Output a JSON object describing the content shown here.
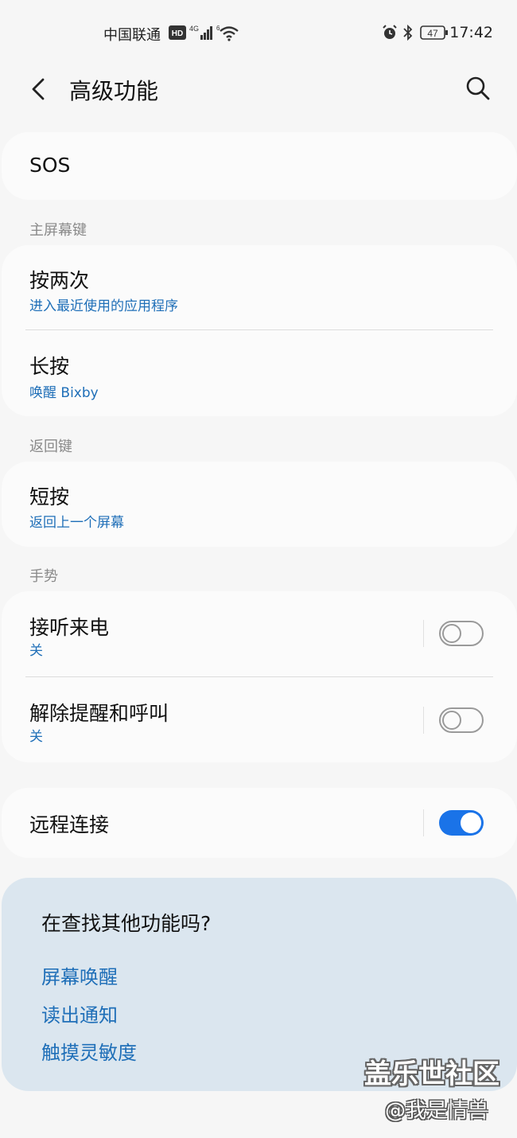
{
  "status_bar": {
    "carrier": "中国联通",
    "hd_badge": "HD",
    "network": "4G",
    "wifi_badge": "6",
    "battery": "47",
    "time": "17:42",
    "icons": [
      "hd-icon",
      "signal-icon",
      "wifi-icon",
      "alarm-icon",
      "bluetooth-icon",
      "battery-icon"
    ]
  },
  "header": {
    "title": "高级功能",
    "icons": [
      "back-arrow-icon",
      "search-icon"
    ]
  },
  "sos": {
    "label": "SOS"
  },
  "home_key": {
    "section_label": "主屏幕键",
    "items": [
      {
        "title": "按两次",
        "subtitle": "进入最近使用的应用程序"
      },
      {
        "title": "长按",
        "subtitle": "唤醒 Bixby"
      }
    ]
  },
  "back_key": {
    "section_label": "返回键",
    "items": [
      {
        "title": "短按",
        "subtitle": "返回上一个屏幕"
      }
    ]
  },
  "gestures": {
    "section_label": "手势",
    "items": [
      {
        "title": "接听来电",
        "subtitle": "关",
        "enabled": false
      },
      {
        "title": "解除提醒和呼叫",
        "subtitle": "关",
        "enabled": false
      }
    ]
  },
  "remote": {
    "title": "远程连接",
    "enabled": true
  },
  "suggestions": {
    "title": "在查找其他功能吗?",
    "links": [
      "屏幕唤醒",
      "读出通知",
      "触摸灵敏度"
    ]
  },
  "watermark": {
    "line1": "盖乐世社区",
    "line2": "@我是情兽"
  },
  "colors": {
    "accent": "#1a73e8",
    "link": "#1f6fb8",
    "background": "#f6f6f6",
    "suggest_bg": "#dbe6ef"
  }
}
